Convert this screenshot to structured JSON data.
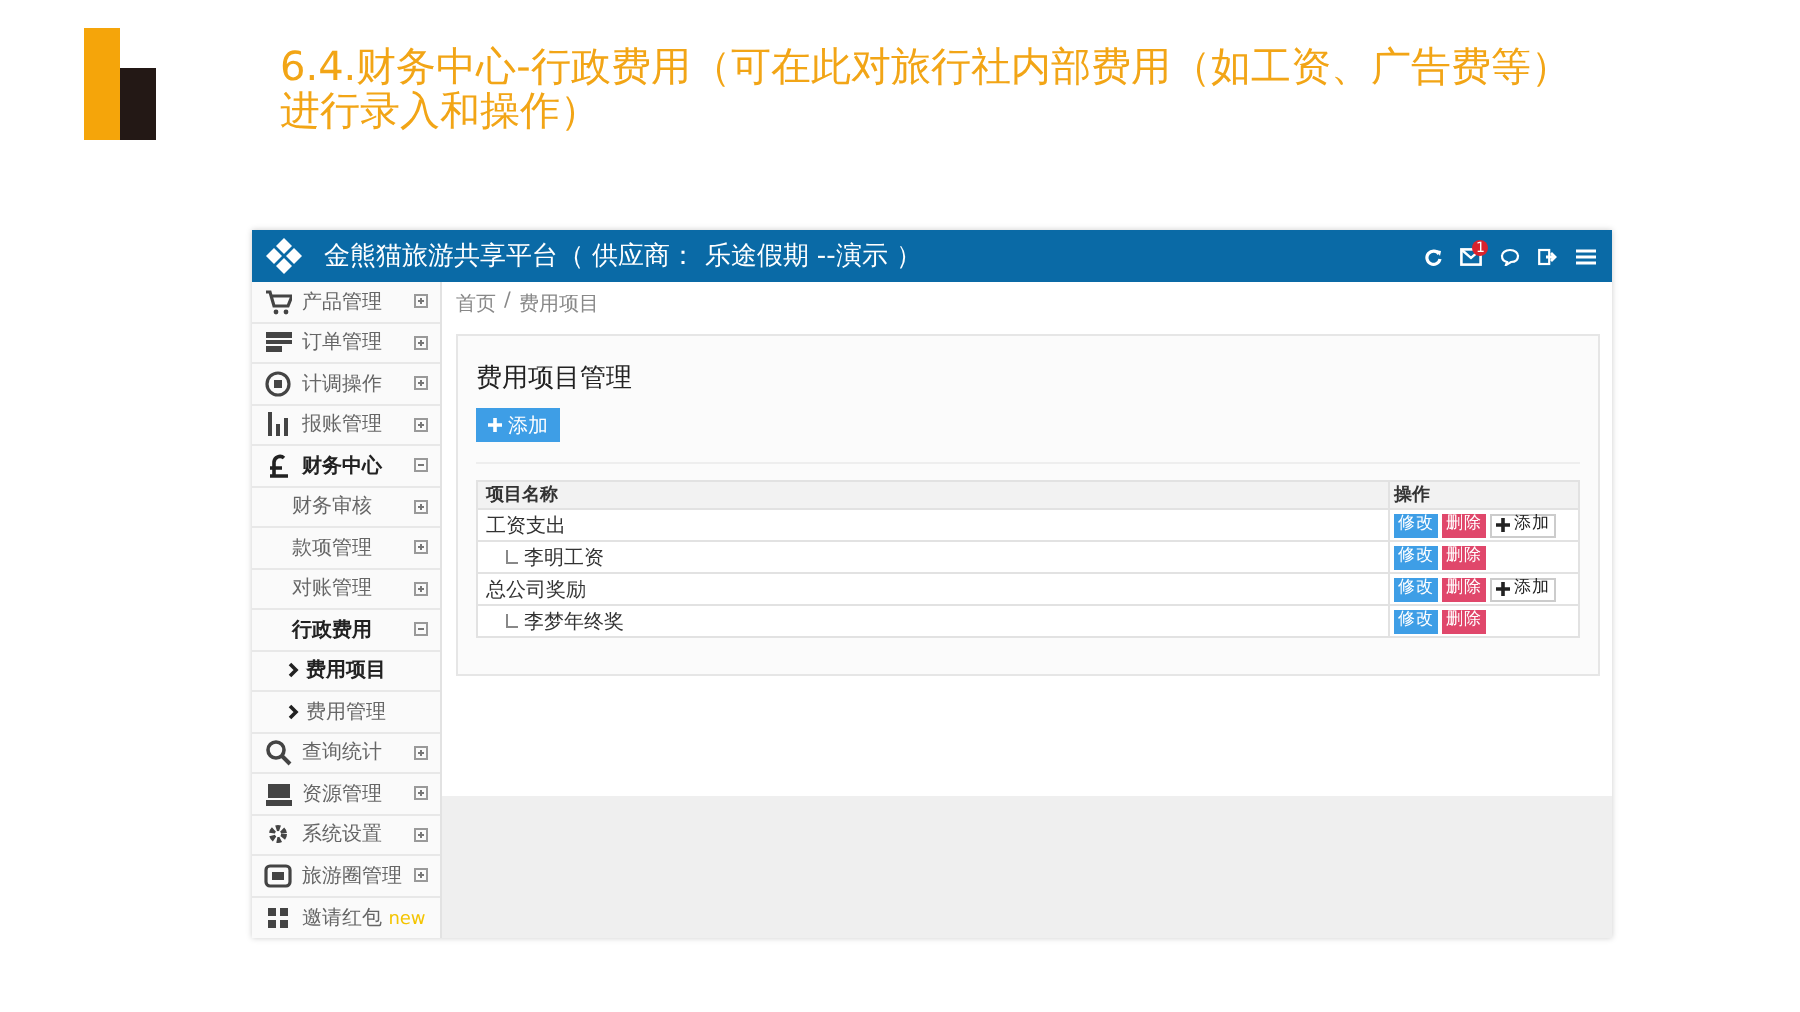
{
  "slide": {
    "title": "6.4.财务中心-行政费用（可在此对旅行社内部费用（如工资、广告费等）进行录入和操作）"
  },
  "app": {
    "title": "金熊猫旅游共享平台（ 供应商： 乐途假期 --演示 ）",
    "message_count": "1"
  },
  "sidebar": {
    "items": [
      {
        "label": "产品管理",
        "expanded": false,
        "selected": false
      },
      {
        "label": "订单管理",
        "expanded": false,
        "selected": false
      },
      {
        "label": "计调操作",
        "expanded": false,
        "selected": false
      },
      {
        "label": "报账管理",
        "expanded": false,
        "selected": false
      },
      {
        "label": "财务中心",
        "expanded": true,
        "selected": true,
        "children": [
          {
            "label": "财务审核",
            "expanded": false,
            "selected": false
          },
          {
            "label": "款项管理",
            "expanded": false,
            "selected": false
          },
          {
            "label": "对账管理",
            "expanded": false,
            "selected": false
          },
          {
            "label": "行政费用",
            "expanded": true,
            "selected": true,
            "children": [
              {
                "label": "费用项目",
                "selected": true
              },
              {
                "label": "费用管理",
                "selected": false
              }
            ]
          }
        ]
      },
      {
        "label": "查询统计",
        "expanded": false,
        "selected": false
      },
      {
        "label": "资源管理",
        "expanded": false,
        "selected": false
      },
      {
        "label": "系统设置",
        "expanded": false,
        "selected": false
      },
      {
        "label": "旅游圈管理",
        "expanded": false,
        "selected": false
      },
      {
        "label": "邀请红包",
        "selected": false,
        "badge": "new"
      }
    ]
  },
  "breadcrumb": {
    "items": [
      "首页",
      "费用项目"
    ],
    "separator": "/"
  },
  "panel": {
    "title": "费用项目管理",
    "add_button": "添加",
    "table": {
      "columns": [
        "项目名称",
        "操作"
      ],
      "rows": [
        {
          "name": "工资支出",
          "actions": [
            {
              "kind": "edit",
              "label": "修改"
            },
            {
              "kind": "delete",
              "label": "删除"
            },
            {
              "kind": "add",
              "label": "添加"
            }
          ],
          "children": [
            {
              "name": "李明工资",
              "actions": [
                {
                  "kind": "edit",
                  "label": "修改"
                },
                {
                  "kind": "delete",
                  "label": "删除"
                }
              ]
            }
          ]
        },
        {
          "name": "总公司奖励",
          "actions": [
            {
              "kind": "edit",
              "label": "修改"
            },
            {
              "kind": "delete",
              "label": "删除"
            },
            {
              "kind": "add",
              "label": "添加"
            }
          ],
          "children": [
            {
              "name": "李梦年终奖",
              "actions": [
                {
                  "kind": "edit",
                  "label": "修改"
                },
                {
                  "kind": "delete",
                  "label": "删除"
                }
              ]
            }
          ]
        }
      ]
    }
  }
}
